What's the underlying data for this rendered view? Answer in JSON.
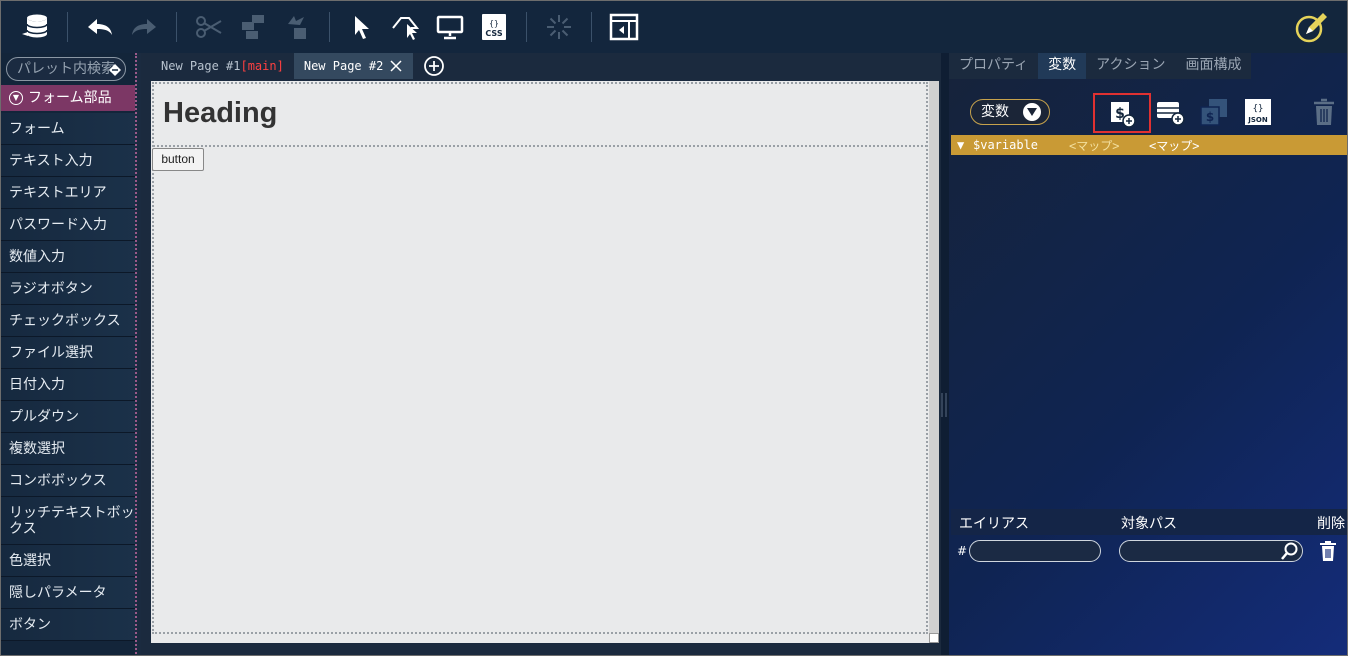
{
  "toolbar": {
    "icons": [
      "database-icon",
      "undo-icon",
      "redo-icon",
      "cut-icon",
      "copy-icon",
      "paste-icon",
      "select-pointer-icon",
      "select-area-icon",
      "preview-monitor-icon",
      "css-icon",
      "loading-icon",
      "layout-icon",
      "edit-pencil-icon"
    ],
    "css_label": "CSS"
  },
  "palette": {
    "search_placeholder": "パレット内検索",
    "group_label": "フォーム部品",
    "items": [
      "フォーム",
      "テキスト入力",
      "テキストエリア",
      "パスワード入力",
      "数値入力",
      "ラジオボタン",
      "チェックボックス",
      "ファイル選択",
      "日付入力",
      "プルダウン",
      "複数選択",
      "コンボボックス",
      "リッチテキストボックス",
      "色選択",
      "隠しパラメータ",
      "ボタン"
    ]
  },
  "tabs": {
    "page1_label": "New Page #1",
    "page1_main": "[main]",
    "page2_label": "New Page #2"
  },
  "canvas": {
    "heading": "Heading",
    "button_label": "button"
  },
  "right_panel": {
    "tabs": [
      "プロパティ",
      "変数",
      "アクション",
      "画面構成"
    ],
    "active_tab": "変数",
    "dropdown_label": "変数",
    "json_label": "JSON",
    "variable": {
      "name": "$variable",
      "type_placeholder": "<マップ>",
      "type_value": "<マップ>"
    },
    "alias_table": {
      "col_alias": "エイリアス",
      "col_path": "対象パス",
      "col_delete": "削除",
      "row_prefix": "#"
    }
  },
  "colors": {
    "accent_gold": "#c99a35",
    "group_purple": "#7c3765",
    "highlight_red": "#e03131"
  }
}
